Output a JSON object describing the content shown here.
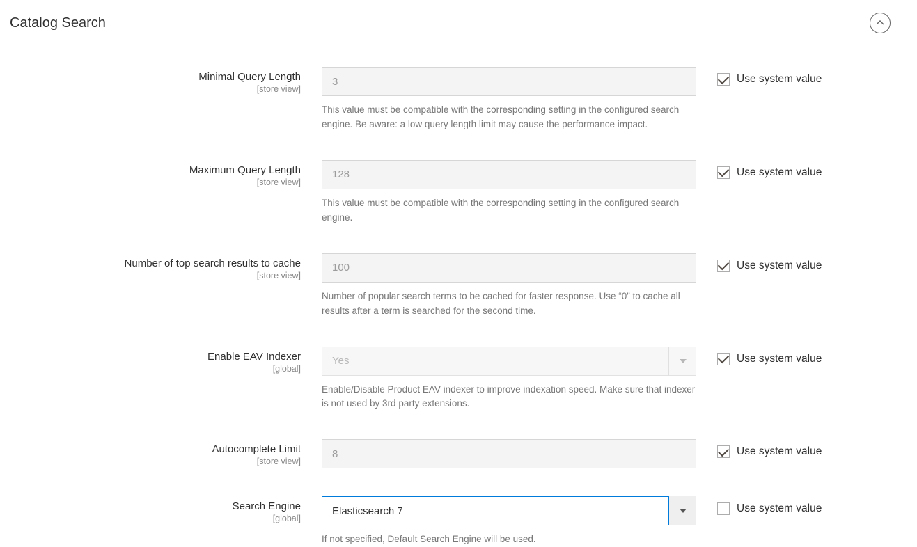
{
  "section": {
    "title": "Catalog Search"
  },
  "use_system_label": "Use system value",
  "fields": {
    "min_query": {
      "label": "Minimal Query Length",
      "scope": "[store view]",
      "value": "3",
      "note": "This value must be compatible with the corresponding setting in the configured search engine. Be aware: a low query length limit may cause the performance impact.",
      "use_system": true
    },
    "max_query": {
      "label": "Maximum Query Length",
      "scope": "[store view]",
      "value": "128",
      "note": "This value must be compatible with the corresponding setting in the configured search engine.",
      "use_system": true
    },
    "top_cache": {
      "label": "Number of top search results to cache",
      "scope": "[store view]",
      "value": "100",
      "note": "Number of popular search terms to be cached for faster response. Use “0” to cache all results after a term is searched for the second time.",
      "use_system": true
    },
    "eav": {
      "label": "Enable EAV Indexer",
      "scope": "[global]",
      "value": "Yes",
      "note": "Enable/Disable Product EAV indexer to improve indexation speed. Make sure that indexer is not used by 3rd party extensions.",
      "use_system": true
    },
    "autocomplete": {
      "label": "Autocomplete Limit",
      "scope": "[store view]",
      "value": "8",
      "use_system": true
    },
    "engine": {
      "label": "Search Engine",
      "scope": "[global]",
      "value": "Elasticsearch 7",
      "note": "If not specified, Default Search Engine will be used.",
      "use_system": false
    }
  }
}
